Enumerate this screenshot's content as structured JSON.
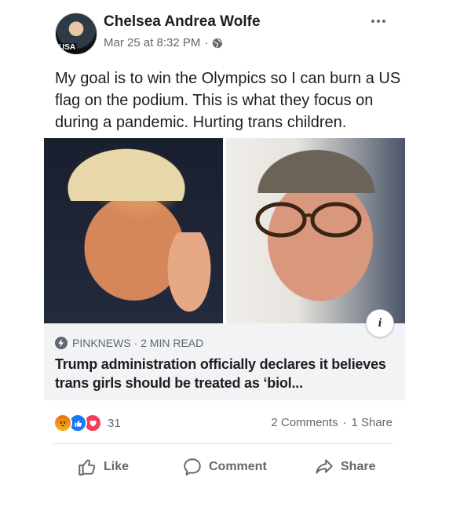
{
  "post": {
    "author": "Chelsea Andrea Wolfe",
    "avatar_badge": "USA",
    "timestamp": "Mar 25 at 8:32 PM",
    "separator": "·",
    "audience_icon": "globe-icon",
    "more_icon": "more-options-icon",
    "text": "My goal is to win the Olympics so I can burn a US flag on the podium. This is what they focus on during a pandemic. Hurting trans children."
  },
  "link_preview": {
    "source": "PINKNEWS · 2 MIN READ",
    "source_icon": "bolt-icon",
    "headline": "Trump administration officially declares it believes trans girls should be treated as ‘biol...",
    "info_label": "i"
  },
  "engagement": {
    "reactions": [
      "angry-reaction-icon",
      "like-reaction-icon",
      "love-reaction-icon"
    ],
    "reaction_count": "31",
    "comments": "2 Comments",
    "dot": "·",
    "shares": "1 Share"
  },
  "actions": {
    "like": "Like",
    "comment": "Comment",
    "share": "Share"
  },
  "colors": {
    "text": "#1c1e21",
    "secondary": "#65676b",
    "link_bg": "#f2f3f5",
    "like_blue": "#1877f2",
    "love_red": "#f33e58",
    "angry_orange": "#e9710f"
  }
}
